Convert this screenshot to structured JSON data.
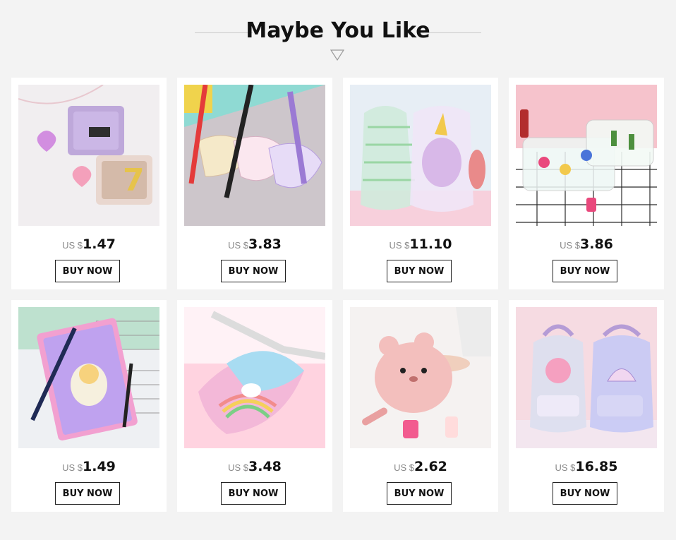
{
  "header": {
    "title": "Maybe You Like"
  },
  "products": [
    {
      "currency": "US $",
      "price": "1.47",
      "button": "BUY NOW",
      "image_icon": "purple-pink-clear-wallets",
      "palette": [
        "#f1eef0",
        "#b59bd6",
        "#f2b7c9",
        "#7a5a40"
      ]
    },
    {
      "currency": "US $",
      "price": "3.83",
      "button": "BUY NOW",
      "image_icon": "clear-fanny-packs",
      "palette": [
        "#8fdad3",
        "#f7b9c7",
        "#e43a3a",
        "#9b7ad4"
      ]
    },
    {
      "currency": "US $",
      "price": "11.10",
      "button": "BUY NOW",
      "image_icon": "clear-drawstring-backpacks",
      "palette": [
        "#e7eef5",
        "#d8b8e8",
        "#9ad6a4",
        "#f7d0dc"
      ]
    },
    {
      "currency": "US $",
      "price": "3.86",
      "button": "BUY NOW",
      "image_icon": "clear-cosmetic-pouches",
      "palette": [
        "#f6c3cc",
        "#ffffff",
        "#4d8f3e",
        "#e9487c"
      ]
    },
    {
      "currency": "US $",
      "price": "1.49",
      "button": "BUY NOW",
      "image_icon": "passport-cover",
      "palette": [
        "#9fd7b8",
        "#f2a0d0",
        "#bfa2ef",
        "#f6f0de"
      ]
    },
    {
      "currency": "US $",
      "price": "3.48",
      "button": "BUY NOW",
      "image_icon": "sequin-unicorn-waist-bag",
      "palette": [
        "#ffd3e0",
        "#a8dcf2",
        "#f3b8d8",
        "#dcdcdc"
      ]
    },
    {
      "currency": "US $",
      "price": "2.62",
      "button": "BUY NOW",
      "image_icon": "plush-bear-makeup-bag",
      "palette": [
        "#f5f2f1",
        "#f3bfbd",
        "#e9a0a0",
        "#ffdcdc"
      ]
    },
    {
      "currency": "US $",
      "price": "16.85",
      "button": "BUY NOW",
      "image_icon": "holographic-mini-backpacks",
      "palette": [
        "#f6dbe2",
        "#dcdff0",
        "#c6c9f5",
        "#f5a0c0"
      ]
    }
  ]
}
